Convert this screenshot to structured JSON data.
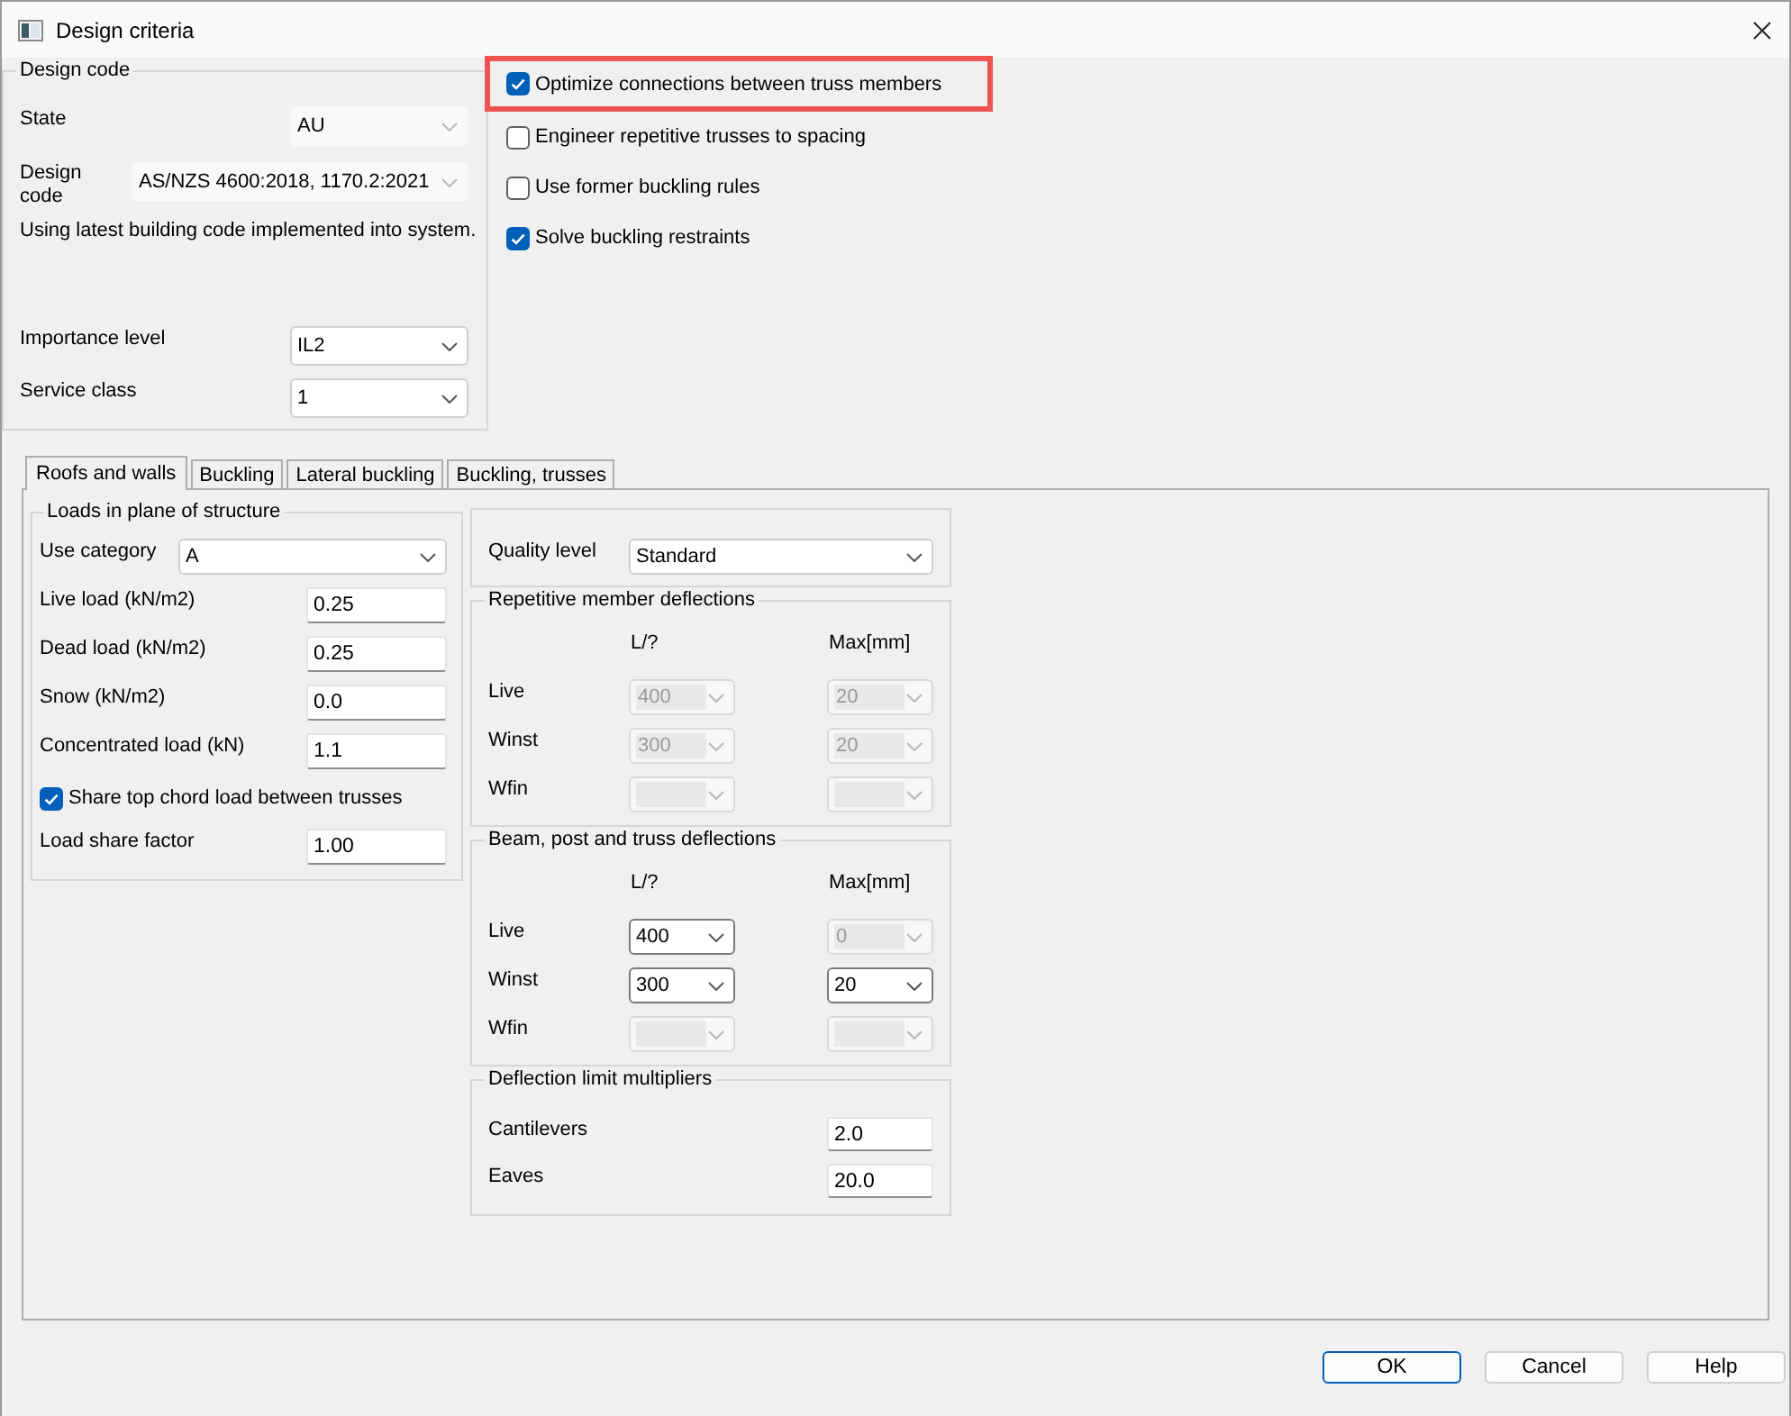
{
  "window": {
    "title": "Design criteria"
  },
  "design_code": {
    "title": "Design code",
    "state": {
      "label": "State",
      "value": "AU",
      "disabled": true
    },
    "code": {
      "label": "Design code",
      "value": "AS/NZS 4600:2018, 1170.2:2021",
      "disabled": true
    },
    "note": "Using latest building code implemented into system.",
    "importance_level": {
      "label": "Importance level",
      "value": "IL2",
      "disabled": false
    },
    "service_class": {
      "label": "Service class",
      "value": "1",
      "disabled": false
    }
  },
  "options": [
    {
      "label": "Optimize connections between truss members",
      "checked": true,
      "highlighted": true
    },
    {
      "label": "Engineer repetitive trusses to spacing",
      "checked": false,
      "highlighted": false
    },
    {
      "label": "Use former buckling rules",
      "checked": false,
      "highlighted": false
    },
    {
      "label": "Solve buckling restraints",
      "checked": true,
      "highlighted": false
    }
  ],
  "tabs": [
    {
      "label": "Roofs and walls",
      "selected": true
    },
    {
      "label": "Buckling",
      "selected": false
    },
    {
      "label": "Lateral buckling",
      "selected": false
    },
    {
      "label": "Buckling, trusses",
      "selected": false
    }
  ],
  "loads": {
    "title": "Loads in plane of structure",
    "use_category": {
      "label": "Use category",
      "value": "A"
    },
    "fields": [
      {
        "label": "Live load (kN/m2)",
        "value": "0.25"
      },
      {
        "label": "Dead load (kN/m2)",
        "value": "0.25"
      },
      {
        "label": "Snow (kN/m2)",
        "value": "0.0"
      },
      {
        "label": "Concentrated load (kN)",
        "value": "1.1"
      }
    ],
    "share_load": {
      "label": "Share top chord load between trusses",
      "checked": true
    },
    "share_factor": {
      "label": "Load share factor",
      "value": "1.00"
    }
  },
  "quality": {
    "label": "Quality level",
    "value": "Standard"
  },
  "deflection_groups": [
    {
      "title": "Repetitive member deflections",
      "columns": [
        "L/?",
        "Max[mm]"
      ],
      "rows": [
        {
          "label": "Live",
          "cells": [
            {
              "value": "400",
              "disabled": true
            },
            {
              "value": "20",
              "disabled": true
            }
          ]
        },
        {
          "label": "Winst",
          "cells": [
            {
              "value": "300",
              "disabled": true
            },
            {
              "value": "20",
              "disabled": true
            }
          ]
        },
        {
          "label": "Wfin",
          "cells": [
            {
              "disabled": true
            },
            {
              "disabled": true
            }
          ]
        }
      ]
    },
    {
      "title": "Beam, post and truss deflections",
      "columns": [
        "L/?",
        "Max[mm]"
      ],
      "rows": [
        {
          "label": "Live",
          "cells": [
            {
              "value": "400",
              "disabled": false
            },
            {
              "value": "0",
              "disabled": true
            }
          ]
        },
        {
          "label": "Winst",
          "cells": [
            {
              "value": "300",
              "disabled": false
            },
            {
              "value": "20",
              "disabled": false
            }
          ]
        },
        {
          "label": "Wfin",
          "cells": [
            {
              "disabled": true
            },
            {
              "disabled": true
            }
          ]
        }
      ]
    }
  ],
  "multipliers": {
    "title": "Deflection limit multipliers",
    "rows": [
      {
        "label": "Cantilevers",
        "value": "2.0"
      },
      {
        "label": "Eaves",
        "value": "20.0"
      }
    ]
  },
  "buttons": [
    {
      "label": "OK",
      "default": true
    },
    {
      "label": "Cancel",
      "default": false
    },
    {
      "label": "Help",
      "default": false
    }
  ]
}
